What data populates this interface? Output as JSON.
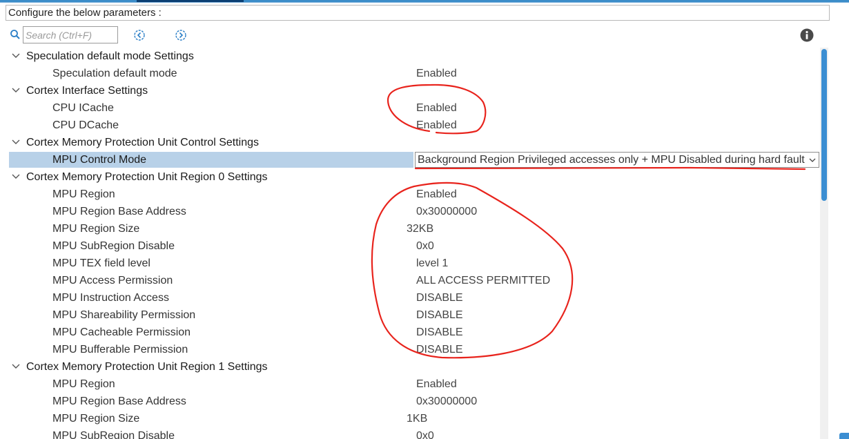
{
  "header": {
    "text": "Configure the below parameters :"
  },
  "toolbar": {
    "search_placeholder": "Search (Ctrl+F)",
    "icons": [
      "search-icon",
      "previous-icon",
      "next-icon",
      "info-icon"
    ]
  },
  "groups": [
    {
      "title": "Speculation default mode Settings",
      "params": [
        {
          "label": "Speculation default mode",
          "value": "Enabled"
        }
      ]
    },
    {
      "title": "Cortex Interface Settings",
      "params": [
        {
          "label": "CPU ICache",
          "value": "Enabled"
        },
        {
          "label": "CPU DCache",
          "value": "Enabled"
        }
      ]
    },
    {
      "title": "Cortex Memory Protection Unit Control Settings",
      "params": [
        {
          "label": "MPU Control Mode",
          "value": "Background Region Privileged accesses only + MPU Disabled during hard fault, NMI and FAULTMASK handlers"
        }
      ]
    },
    {
      "title": "Cortex Memory Protection Unit Region 0 Settings",
      "params": [
        {
          "label": "MPU Region",
          "value": "Enabled"
        },
        {
          "label": "MPU Region Base Address",
          "value": "0x30000000"
        },
        {
          "label": "MPU Region Size",
          "value": "32KB"
        },
        {
          "label": "MPU SubRegion Disable",
          "value": "0x0"
        },
        {
          "label": "MPU TEX field level",
          "value": "level 1"
        },
        {
          "label": "MPU Access Permission",
          "value": "ALL ACCESS PERMITTED"
        },
        {
          "label": "MPU Instruction Access",
          "value": "DISABLE"
        },
        {
          "label": "MPU Shareability Permission",
          "value": "DISABLE"
        },
        {
          "label": "MPU Cacheable Permission",
          "value": "DISABLE"
        },
        {
          "label": "MPU Bufferable  Permission",
          "value": "DISABLE"
        }
      ]
    },
    {
      "title": "Cortex Memory Protection Unit Region 1 Settings",
      "params": [
        {
          "label": "MPU Region",
          "value": "Enabled"
        },
        {
          "label": "MPU Region Base Address",
          "value": "0x30000000"
        },
        {
          "label": "MPU Region Size",
          "value": "1KB"
        },
        {
          "label": "MPU SubRegion Disable",
          "value": "0x0"
        }
      ]
    }
  ],
  "colors": {
    "selected_row": "#b8d1e8",
    "accent": "#3b8ed2",
    "annotation": "#e8231c"
  }
}
